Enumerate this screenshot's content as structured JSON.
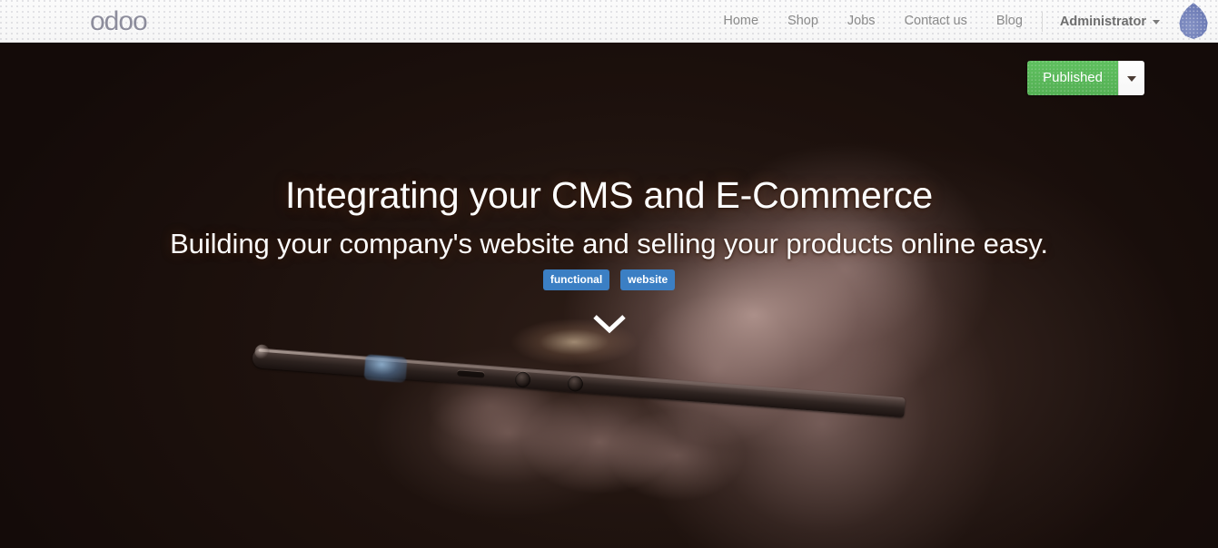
{
  "topbar": {
    "brand": "odoo",
    "brand_icon": "odoo-logo",
    "nav_links": [
      {
        "label": "Home"
      },
      {
        "label": "Shop"
      },
      {
        "label": "Jobs"
      },
      {
        "label": "Contact us"
      },
      {
        "label": "Blog"
      }
    ],
    "user": {
      "name": "Administrator",
      "caret_icon": "caret-down-icon",
      "avatar_icon": "user-avatar-droplet-icon"
    }
  },
  "publish": {
    "label": "Published",
    "dropdown_icon": "caret-down-icon",
    "accent_color": "#5cb85c"
  },
  "hero": {
    "title": "Integrating your CMS and E-Commerce",
    "subtitle": "Building your company's website and selling your products online easy.",
    "tags": [
      {
        "label": "functional"
      },
      {
        "label": "website"
      }
    ],
    "tag_color": "#3b7fc4",
    "scroll_icon": "chevron-down-icon",
    "background_image": "dark-photo-hands-holding-smartphone",
    "background_color": "#1a0f0c"
  }
}
